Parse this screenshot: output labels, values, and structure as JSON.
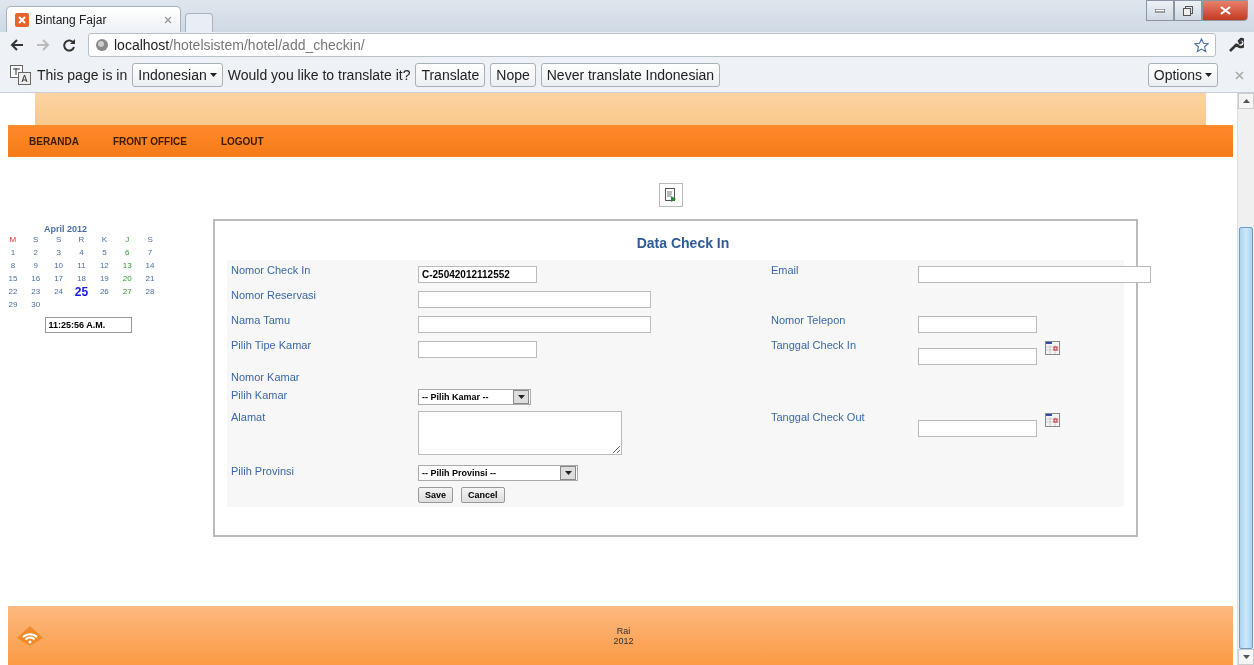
{
  "browser": {
    "tab_title": "Bintang Fajar",
    "url_host": "localhost",
    "url_path": "/hotelsistem/hotel/add_checkin/"
  },
  "translate_bar": {
    "prefix": "This page is in",
    "language": "Indonesian",
    "question": "Would you like to translate it?",
    "buttons": [
      "Translate",
      "Nope",
      "Never translate Indonesian"
    ],
    "options": "Options"
  },
  "nav": {
    "items": [
      "BERANDA",
      "FRONT OFFICE",
      "LOGOUT"
    ]
  },
  "calendar": {
    "title": "April 2012",
    "weekdays": [
      {
        "label": "M",
        "kind": "sunday"
      },
      {
        "label": "S",
        "kind": "weekday"
      },
      {
        "label": "S",
        "kind": "weekday"
      },
      {
        "label": "R",
        "kind": "weekday"
      },
      {
        "label": "K",
        "kind": "weekday"
      },
      {
        "label": "J",
        "kind": "friday"
      },
      {
        "label": "S",
        "kind": "weekday"
      }
    ],
    "weeks": [
      [
        {
          "label": "1",
          "kind": "weekday",
          "selected": false
        },
        {
          "label": "2",
          "kind": "weekday",
          "selected": false
        },
        {
          "label": "3",
          "kind": "weekday",
          "selected": false
        },
        {
          "label": "4",
          "kind": "weekday",
          "selected": false
        },
        {
          "label": "5",
          "kind": "weekday",
          "selected": false
        },
        {
          "label": "6",
          "kind": "friday",
          "selected": false
        },
        {
          "label": "7",
          "kind": "weekday",
          "selected": false
        }
      ],
      [
        {
          "label": "8",
          "kind": "weekday",
          "selected": false
        },
        {
          "label": "9",
          "kind": "weekday",
          "selected": false
        },
        {
          "label": "10",
          "kind": "weekday",
          "selected": false
        },
        {
          "label": "11",
          "kind": "weekday",
          "selected": false
        },
        {
          "label": "12",
          "kind": "weekday",
          "selected": false
        },
        {
          "label": "13",
          "kind": "friday",
          "selected": false
        },
        {
          "label": "14",
          "kind": "weekday",
          "selected": false
        }
      ],
      [
        {
          "label": "15",
          "kind": "weekday",
          "selected": false
        },
        {
          "label": "16",
          "kind": "weekday",
          "selected": false
        },
        {
          "label": "17",
          "kind": "weekday",
          "selected": false
        },
        {
          "label": "18",
          "kind": "weekday",
          "selected": false
        },
        {
          "label": "19",
          "kind": "weekday",
          "selected": false
        },
        {
          "label": "20",
          "kind": "friday",
          "selected": false
        },
        {
          "label": "21",
          "kind": "weekday",
          "selected": false
        }
      ],
      [
        {
          "label": "22",
          "kind": "weekday",
          "selected": false
        },
        {
          "label": "23",
          "kind": "weekday",
          "selected": false
        },
        {
          "label": "24",
          "kind": "weekday",
          "selected": false
        },
        {
          "label": "25",
          "kind": "weekday",
          "selected": true
        },
        {
          "label": "26",
          "kind": "weekday",
          "selected": false
        },
        {
          "label": "27",
          "kind": "friday",
          "selected": false
        },
        {
          "label": "28",
          "kind": "weekday",
          "selected": false
        }
      ],
      [
        {
          "label": "29",
          "kind": "weekday",
          "selected": false
        },
        {
          "label": "30",
          "kind": "weekday",
          "selected": false
        }
      ]
    ],
    "clock": "11:25:56 A.M."
  },
  "form": {
    "title": "Data Check In",
    "rows": [
      {
        "left": {
          "label": "Nomor Check In",
          "kind": "short-text",
          "value": "C-25042012112552"
        },
        "right": {
          "label": "Email",
          "kind": "wide-text"
        }
      },
      {
        "left": {
          "label": "Nomor Reservasi",
          "kind": "wide-text"
        }
      },
      {
        "left": {
          "label": "Nama Tamu",
          "kind": "wide-text"
        },
        "right": {
          "label": "Nomor Telepon",
          "kind": "short-text"
        }
      },
      {
        "left": {
          "label": "Pilih Tipe Kamar",
          "kind": "short-text"
        },
        "right": {
          "label": "Tanggal Check In",
          "kind": "date"
        }
      },
      {
        "left": {
          "label": "Nomor Kamar",
          "kind": "none"
        }
      },
      {
        "left": {
          "label": "Pilih Kamar",
          "kind": "select",
          "value": "-- Pilih Kamar --"
        }
      },
      {
        "left": {
          "label": "Alamat",
          "kind": "textarea"
        },
        "right": {
          "label": "Tanggal Check Out",
          "kind": "date"
        }
      },
      {
        "left": {
          "label": "Pilih Provinsi",
          "kind": "select-wide",
          "value": "-- Pilih Provinsi --"
        }
      }
    ],
    "buttons": [
      "Save",
      "Cancel"
    ]
  },
  "footer": {
    "lines": [
      "Rai",
      "2012"
    ]
  }
}
